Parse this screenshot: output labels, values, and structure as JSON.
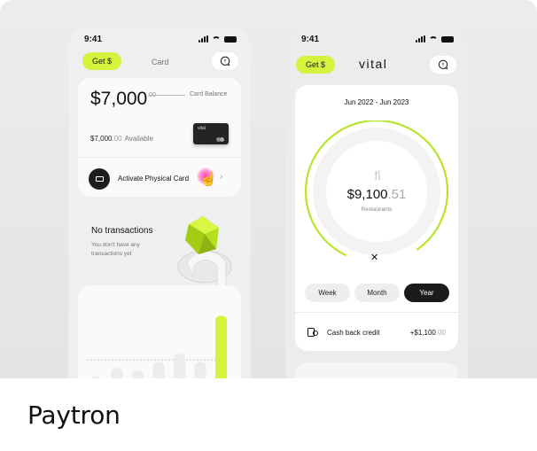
{
  "left_phone": {
    "status_time": "9:41",
    "get_button": "Get $",
    "header_title": "Card",
    "balance": {
      "amount": "$7,000",
      "cents": ".00",
      "label": "Card Balance"
    },
    "available": {
      "amount": "$7,000",
      "cents": ".00",
      "label": "Available"
    },
    "mini_card_brand": "vital",
    "activate_label": "Activate Physical Card",
    "no_transactions_title": "No transactions",
    "no_transactions_sub": "You don't have any transactions yet",
    "bars": [
      0.18,
      0.28,
      0.25,
      0.35,
      0.45,
      0.35,
      0.9
    ],
    "accent": "#d6f23d"
  },
  "right_phone": {
    "status_time": "9:41",
    "get_button": "Get $",
    "logo": "vital",
    "date_range": "Jun 2022 - Jun 2023",
    "amount": "$9,100",
    "amount_cents": ".51",
    "category": "Restaurants",
    "ring_progress": 0.83,
    "periods": [
      {
        "label": "Week",
        "active": false
      },
      {
        "label": "Month",
        "active": false
      },
      {
        "label": "Year",
        "active": true
      }
    ],
    "cashback_label": "Cash back credit",
    "cashback_value": "+$1,100",
    "cashback_cents": ".00"
  },
  "brand": "Paytron"
}
